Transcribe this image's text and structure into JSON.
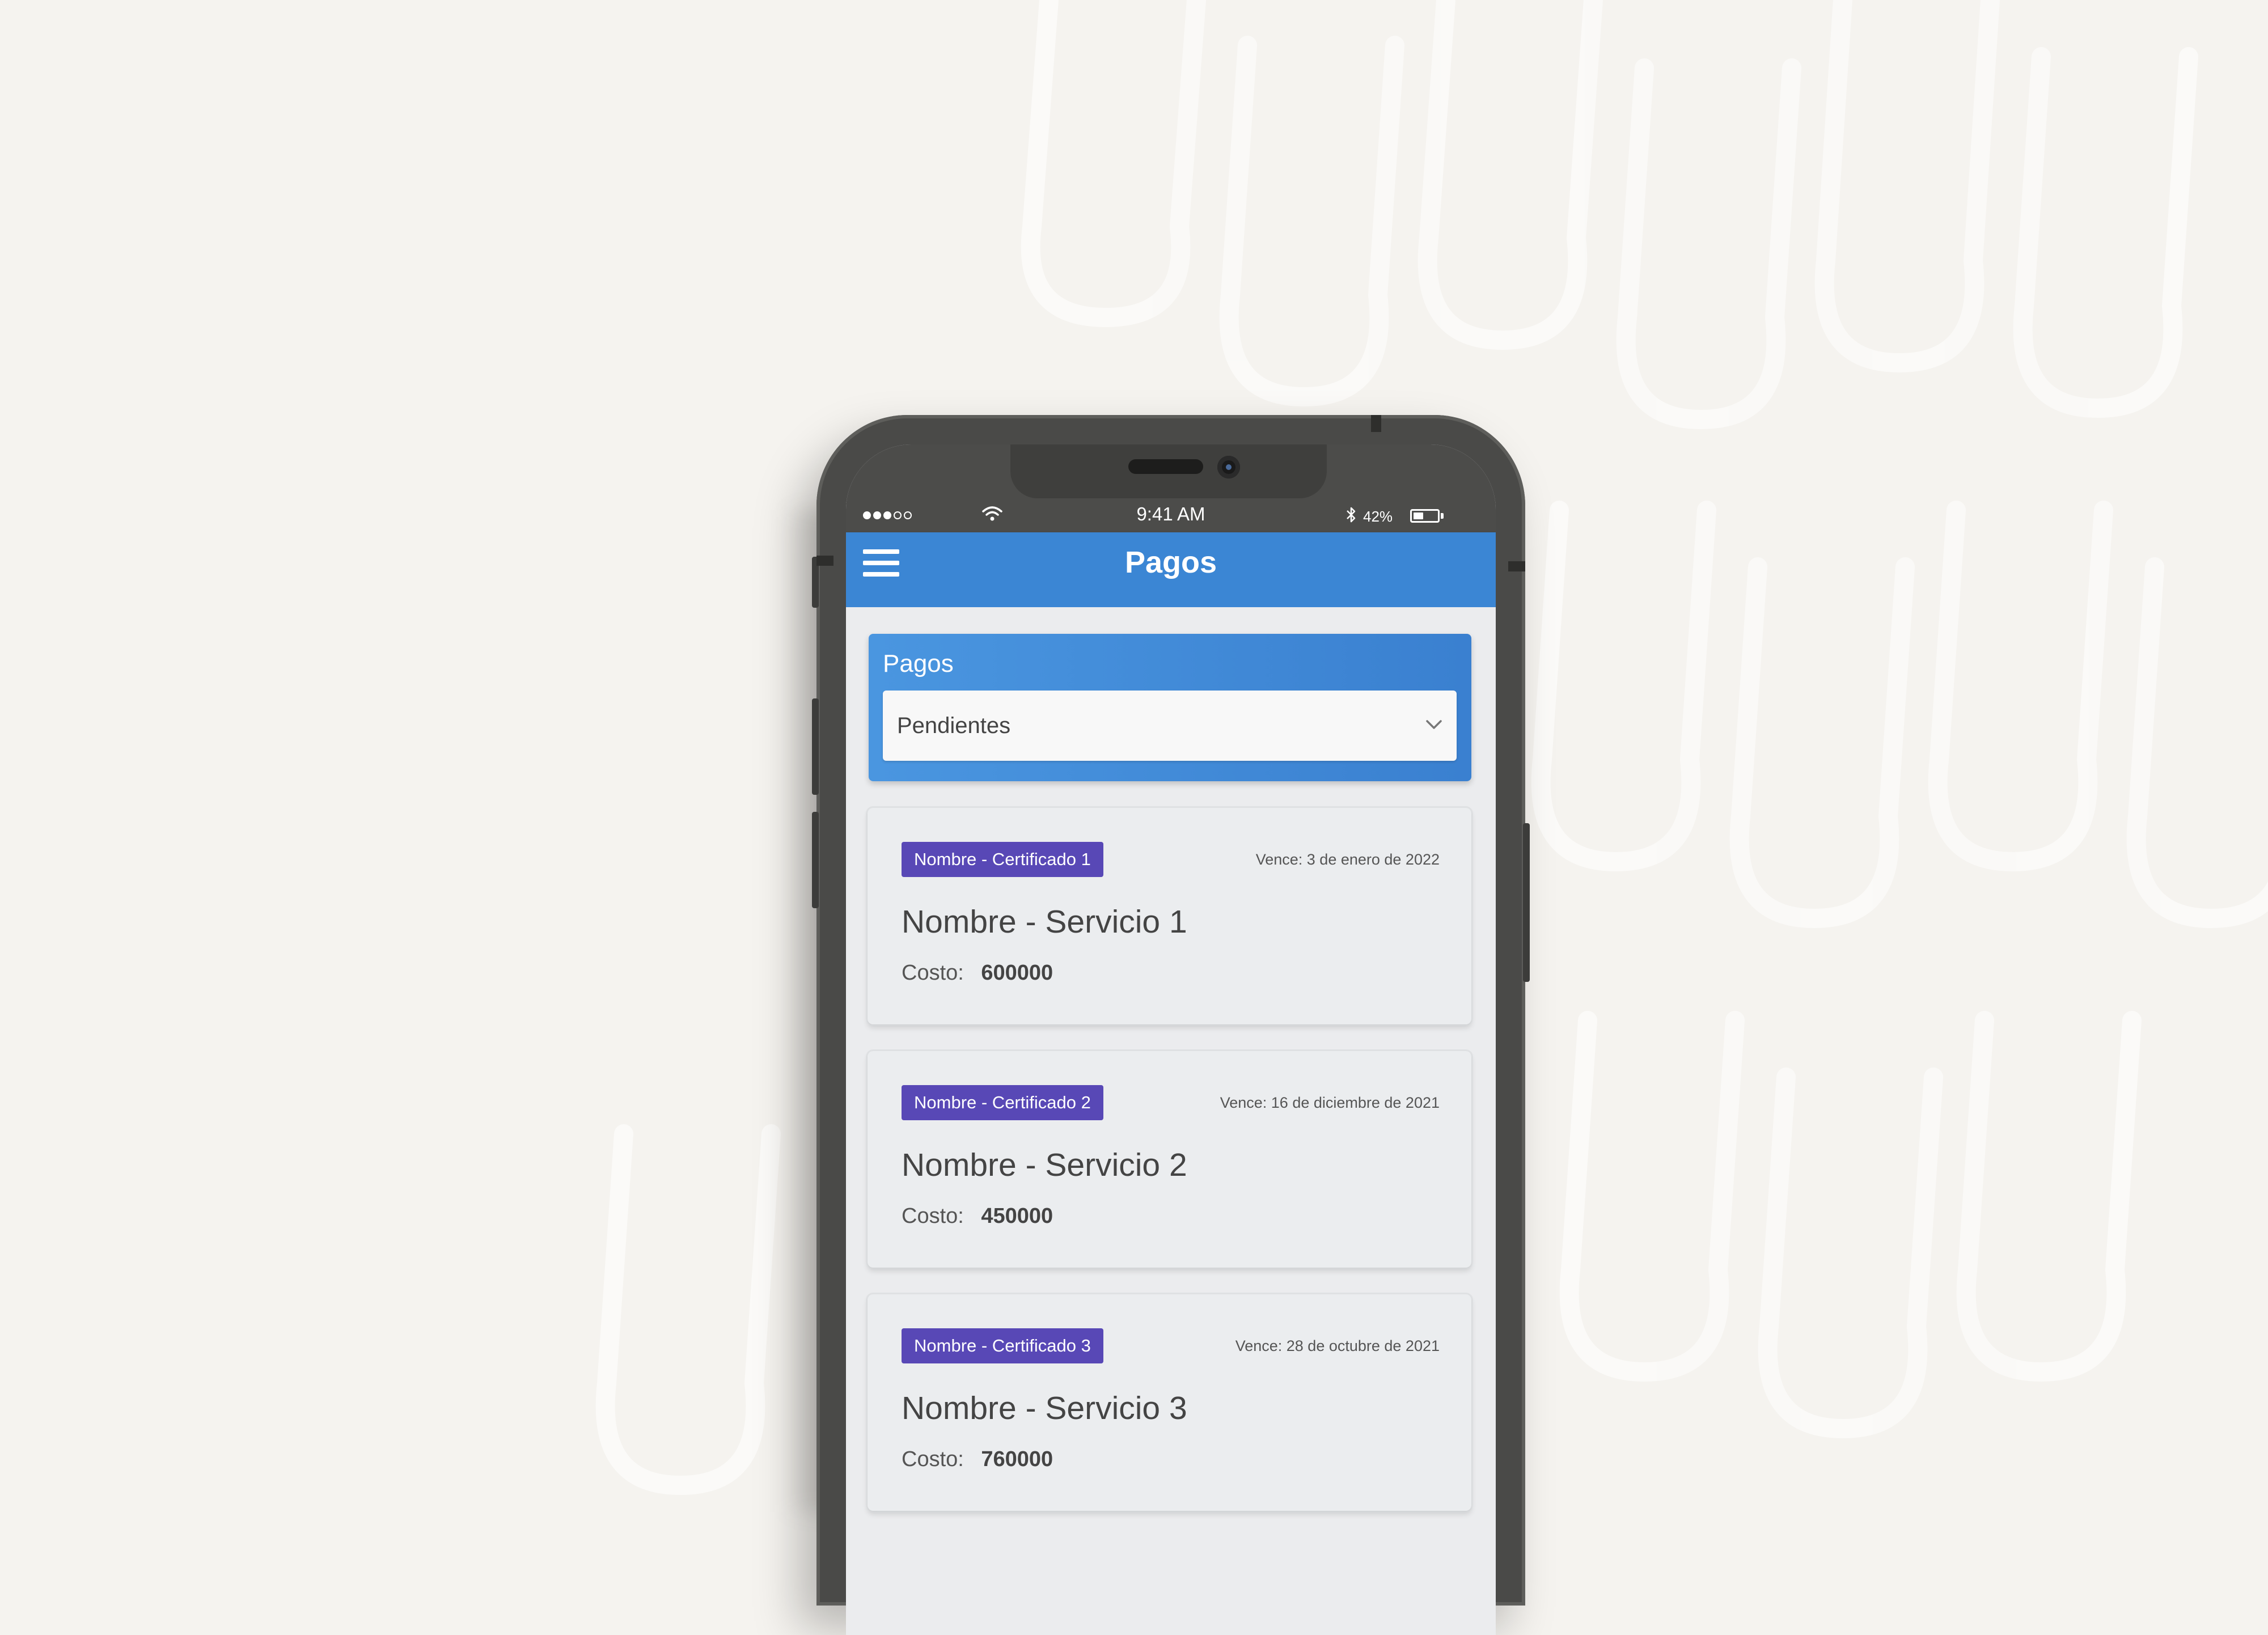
{
  "status_bar": {
    "time": "9:41 AM",
    "battery_percent": "42%",
    "battery_level": 0.42,
    "signal_bars": 3,
    "signal_total": 5
  },
  "app_bar": {
    "title": "Pagos",
    "menu_icon": "hamburger-menu-icon"
  },
  "filter": {
    "label": "Pagos",
    "selected": "Pendientes",
    "dropdown_icon": "chevron-down-icon"
  },
  "payments": [
    {
      "badge": "Nombre - Certificado 1",
      "due": "Vence: 3 de enero de 2022",
      "service": "Nombre - Servicio 1",
      "cost_label": "Costo:",
      "cost_value": "600000"
    },
    {
      "badge": "Nombre - Certificado 2",
      "due": "Vence: 16 de diciembre de 2021",
      "service": "Nombre - Servicio 2",
      "cost_label": "Costo:",
      "cost_value": "450000"
    },
    {
      "badge": "Nombre - Certificado 3",
      "due": "Vence: 28 de octubre de 2021",
      "service": "Nombre - Servicio 3",
      "cost_label": "Costo:",
      "cost_value": "760000"
    }
  ],
  "colors": {
    "app_bar": "#3b86d4",
    "badge": "#5848b6",
    "background": "#f5f3ef",
    "phone_frame": "#4a4a48"
  }
}
